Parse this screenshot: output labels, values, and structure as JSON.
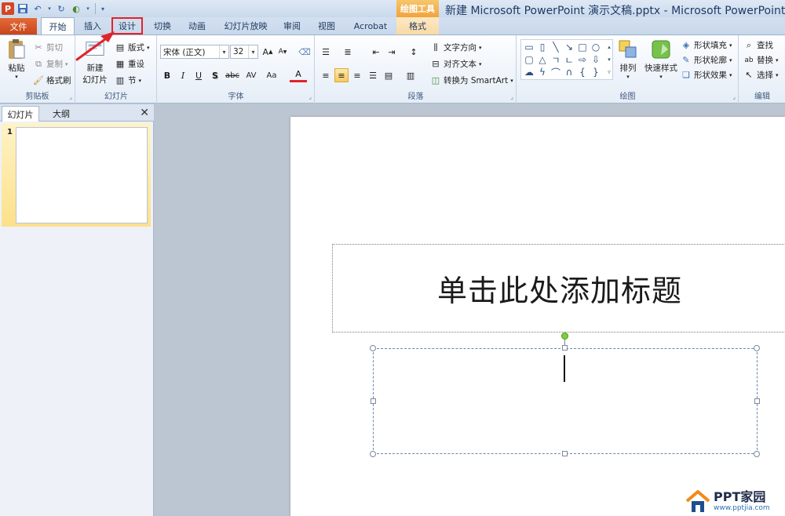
{
  "window": {
    "title": "新建 Microsoft PowerPoint 演示文稿.pptx - Microsoft PowerPoint",
    "context_header": "绘图工具",
    "app_icon": "P"
  },
  "qat": {
    "save_icon": "save-icon",
    "undo_icon": "undo-icon",
    "redo_icon": "redo-icon"
  },
  "tabs": {
    "file": "文件",
    "home": "开始",
    "insert": "插入",
    "design": "设计",
    "transitions": "切换",
    "animations": "动画",
    "slideshow": "幻灯片放映",
    "review": "审阅",
    "view": "视图",
    "acrobat": "Acrobat",
    "format": "格式"
  },
  "ribbon": {
    "clipboard": {
      "label": "剪贴板",
      "paste": "粘贴",
      "cut": "剪切",
      "copy": "复制",
      "format_painter": "格式刷"
    },
    "slides": {
      "label": "幻灯片",
      "new_slide_line1": "新建",
      "new_slide_line2": "幻灯片",
      "layout": "版式",
      "reset": "重设",
      "section": "节"
    },
    "font": {
      "label": "字体",
      "font_name": "宋体 (正文)",
      "font_size": "32",
      "bold": "B",
      "italic": "I",
      "underline": "U",
      "shadow": "S",
      "strikethrough": "abc",
      "spacing": "AV",
      "case": "Aa",
      "color": "A"
    },
    "paragraph": {
      "label": "段落",
      "text_direction": "文字方向",
      "align_text": "对齐文本",
      "convert_smartart": "转换为 SmartArt"
    },
    "drawing": {
      "label": "绘图",
      "arrange": "排列",
      "quick_styles": "快速样式",
      "shape_fill": "形状填充",
      "shape_outline": "形状轮廓",
      "shape_effects": "形状效果"
    },
    "editing": {
      "label": "编辑",
      "find": "查找",
      "replace": "替换",
      "select": "选择"
    }
  },
  "panel": {
    "tab_slides": "幻灯片",
    "tab_outline": "大纲",
    "close": "✕",
    "slide_number": "1"
  },
  "slide": {
    "title_placeholder": "单击此处添加标题"
  },
  "watermark": {
    "main": "PPT家园",
    "sub": "www.pptjia.com"
  }
}
